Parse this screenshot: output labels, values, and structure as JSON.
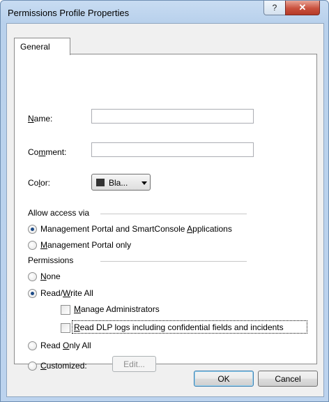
{
  "window": {
    "title": "Permissions Profile Properties",
    "help_glyph": "?",
    "close_glyph": "✕"
  },
  "tab": {
    "label": "General"
  },
  "fields": {
    "name": {
      "label_pre": "",
      "label_key": "N",
      "label_post": "ame:",
      "value": ""
    },
    "comment": {
      "label_pre": "Co",
      "label_key": "m",
      "label_post": "ment:",
      "value": ""
    },
    "color": {
      "label_pre": "Co",
      "label_key": "l",
      "label_post": "or:",
      "selected": "Bla...",
      "swatch": "#333333"
    }
  },
  "access": {
    "group_label": "Allow access via",
    "options": [
      {
        "pre": "Management Portal and SmartConsole ",
        "key": "A",
        "post": "pplications",
        "checked": true
      },
      {
        "pre": "",
        "key": "M",
        "post": "anagement Portal only",
        "checked": false
      }
    ]
  },
  "permissions": {
    "group_label": "Permissions",
    "none": {
      "pre": "",
      "key": "N",
      "post": "one",
      "checked": false
    },
    "read_write": {
      "pre": "Read/",
      "key": "W",
      "post": "rite All",
      "checked": true
    },
    "manage_admins": {
      "pre": "",
      "key": "M",
      "post": "anage Administrators",
      "checked": false
    },
    "read_dlp": {
      "pre": "",
      "key": "R",
      "post": "ead DLP logs including confidential fields and incidents",
      "checked": false
    },
    "read_only": {
      "pre": "Read ",
      "key": "O",
      "post": "nly All",
      "checked": false
    },
    "customized": {
      "pre": "",
      "key": "C",
      "post": "ustomized:",
      "checked": false
    },
    "edit_button": "Edit..."
  },
  "buttons": {
    "ok": "OK",
    "cancel": "Cancel"
  },
  "colors": {
    "accent": "#1c4a86",
    "window_frame": "#b9d1ec",
    "close": "#c9503d"
  }
}
